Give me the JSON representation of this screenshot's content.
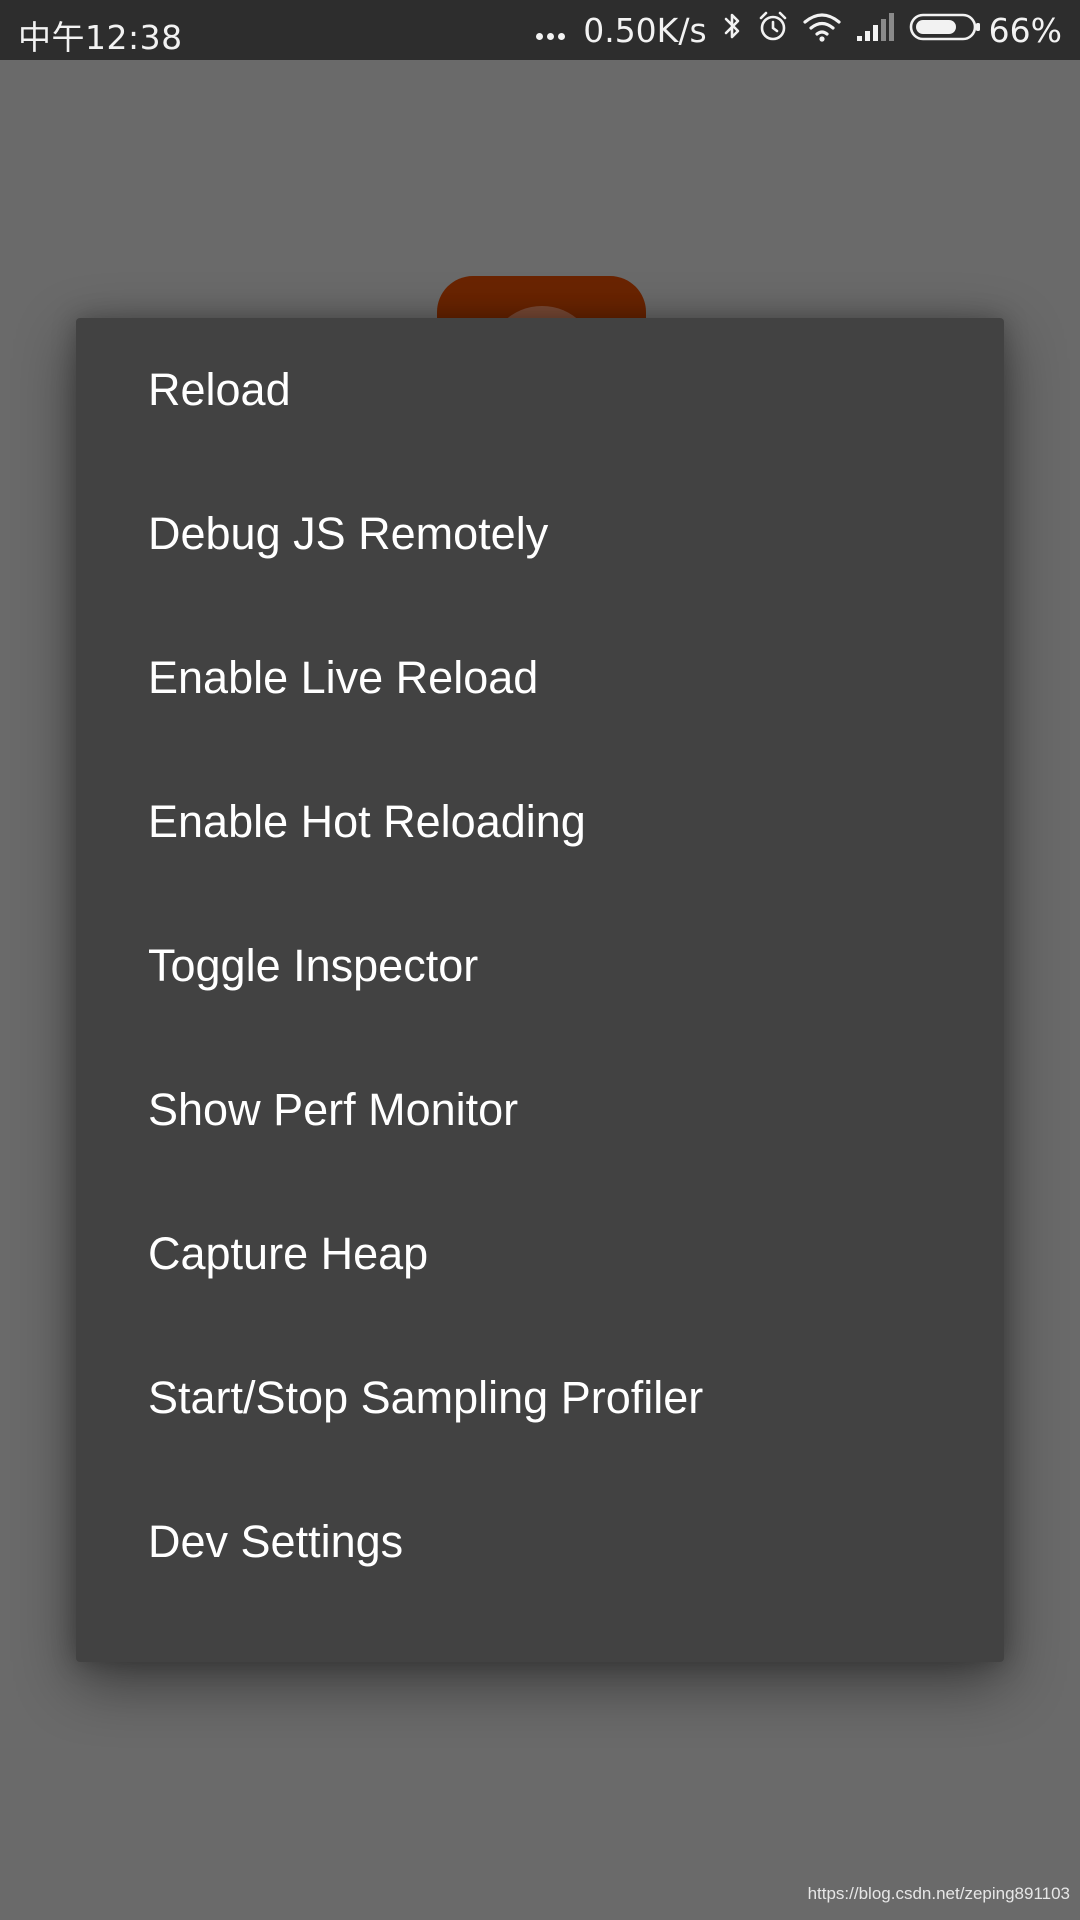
{
  "status_bar": {
    "time": "中午12:38",
    "net_speed": "0.50K/s",
    "battery": "66%",
    "icons": [
      "more-dots-icon",
      "bluetooth-icon",
      "alarm-clock-icon",
      "wifi-icon",
      "signal-icon",
      "battery-icon"
    ]
  },
  "dev_menu": {
    "items": [
      {
        "label": "Reload"
      },
      {
        "label": "Debug JS Remotely"
      },
      {
        "label": "Enable Live Reload"
      },
      {
        "label": "Enable Hot Reloading"
      },
      {
        "label": "Toggle Inspector"
      },
      {
        "label": "Show Perf Monitor"
      },
      {
        "label": "Capture Heap"
      },
      {
        "label": "Start/Stop Sampling Profiler"
      },
      {
        "label": "Dev Settings"
      }
    ]
  },
  "watermark": "https://blog.csdn.net/zeping891103",
  "colors": {
    "scrim": "#6a6a6a",
    "dialog_bg": "#424242",
    "status_bar_bg": "#2d2d2d",
    "app_icon_behind": "#6a2402"
  }
}
